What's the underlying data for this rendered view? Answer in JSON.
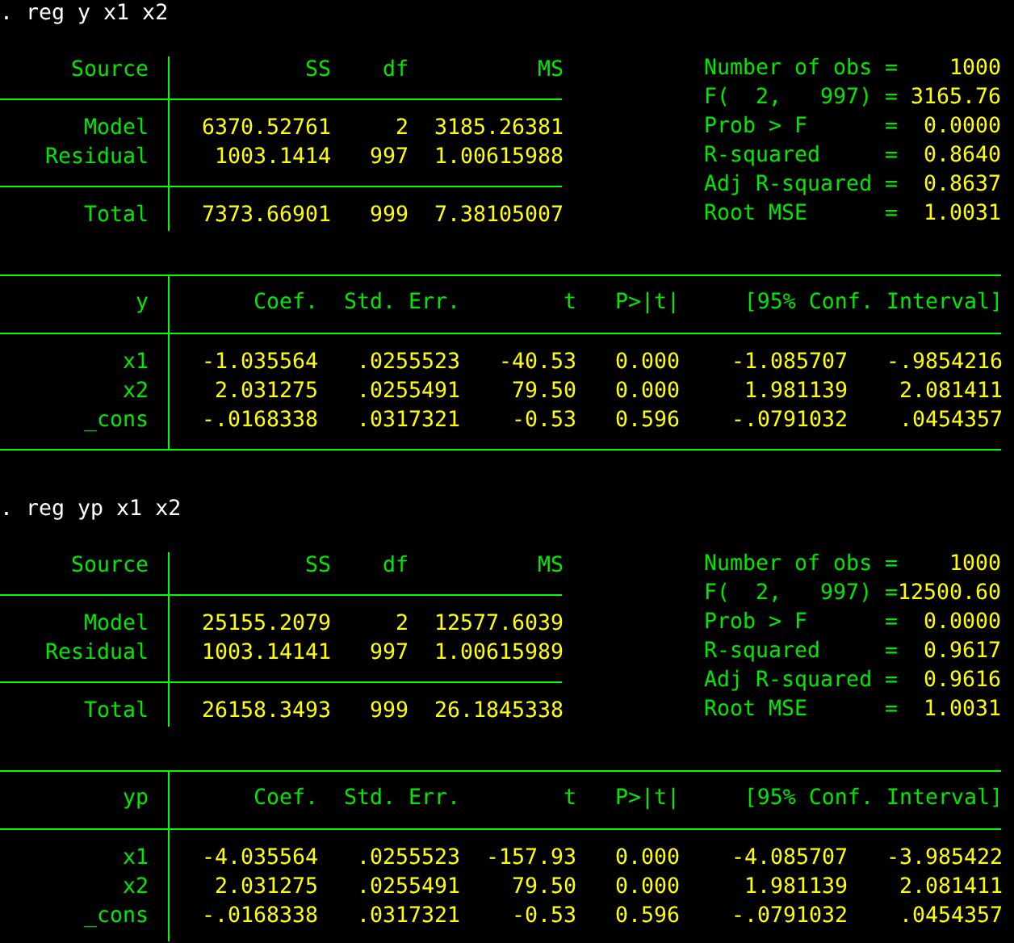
{
  "blocks": [
    {
      "command": ". reg y x1 x2",
      "anova": {
        "columns": [
          "Source",
          "SS",
          "df",
          "MS"
        ],
        "rows": [
          {
            "source": "Model",
            "ss": "6370.52761",
            "df": "2",
            "ms": "3185.26381"
          },
          {
            "source": "Residual",
            "ss": "1003.1414",
            "df": "997",
            "ms": "1.00615988"
          }
        ],
        "total": {
          "source": "Total",
          "ss": "7373.66901",
          "df": "999",
          "ms": "7.38105007"
        }
      },
      "stats": [
        {
          "label": "Number of obs",
          "sign": "=",
          "value": "1000"
        },
        {
          "label": "F(  2,   997)",
          "sign": "=",
          "value": "3165.76"
        },
        {
          "label": "Prob > F",
          "sign": "=",
          "value": "0.0000"
        },
        {
          "label": "R-squared",
          "sign": "=",
          "value": "0.8640"
        },
        {
          "label": "Adj R-squared",
          "sign": "=",
          "value": "0.8637"
        },
        {
          "label": "Root MSE",
          "sign": "=",
          "value": "1.0031"
        }
      ],
      "coef": {
        "columns": [
          "y",
          "Coef.",
          "Std. Err.",
          "t",
          "P>|t|",
          "[95% Conf. Interval]"
        ],
        "closed": true,
        "rows": [
          {
            "variable": "x1",
            "values": [
              "-1.035564",
              ".0255523",
              "-40.53",
              "0.000",
              "-1.085707",
              "-.9854216"
            ]
          },
          {
            "variable": "x2",
            "values": [
              "2.031275",
              ".0255491",
              "79.50",
              "0.000",
              "1.981139",
              "2.081411"
            ]
          },
          {
            "variable": "_cons",
            "values": [
              "-.0168338",
              ".0317321",
              "-0.53",
              "0.596",
              "-.0791032",
              ".0454357"
            ]
          }
        ]
      }
    },
    {
      "command": ". reg yp x1 x2",
      "anova": {
        "columns": [
          "Source",
          "SS",
          "df",
          "MS"
        ],
        "rows": [
          {
            "source": "Model",
            "ss": "25155.2079",
            "df": "2",
            "ms": "12577.6039"
          },
          {
            "source": "Residual",
            "ss": "1003.14141",
            "df": "997",
            "ms": "1.00615989"
          }
        ],
        "total": {
          "source": "Total",
          "ss": "26158.3493",
          "df": "999",
          "ms": "26.1845338"
        }
      },
      "stats": [
        {
          "label": "Number of obs",
          "sign": "=",
          "value": "1000"
        },
        {
          "label": "F(  2,   997)",
          "sign": "=",
          "value": "12500.60"
        },
        {
          "label": "Prob > F",
          "sign": "=",
          "value": "0.0000"
        },
        {
          "label": "R-squared",
          "sign": "=",
          "value": "0.9617"
        },
        {
          "label": "Adj R-squared",
          "sign": "=",
          "value": "0.9616"
        },
        {
          "label": "Root MSE",
          "sign": "=",
          "value": "1.0031"
        }
      ],
      "coef": {
        "columns": [
          "yp",
          "Coef.",
          "Std. Err.",
          "t",
          "P>|t|",
          "[95% Conf. Interval]"
        ],
        "closed": false,
        "rows": [
          {
            "variable": "x1",
            "values": [
              "-4.035564",
              ".0255523",
              "-157.93",
              "0.000",
              "-4.085707",
              "-3.985422"
            ]
          },
          {
            "variable": "x2",
            "values": [
              "2.031275",
              ".0255491",
              "79.50",
              "0.000",
              "1.981139",
              "2.081411"
            ]
          },
          {
            "variable": "_cons",
            "values": [
              "-.0168338",
              ".0317321",
              "-0.53",
              "0.596",
              "-.0791032",
              ".0454357"
            ]
          }
        ]
      }
    }
  ]
}
